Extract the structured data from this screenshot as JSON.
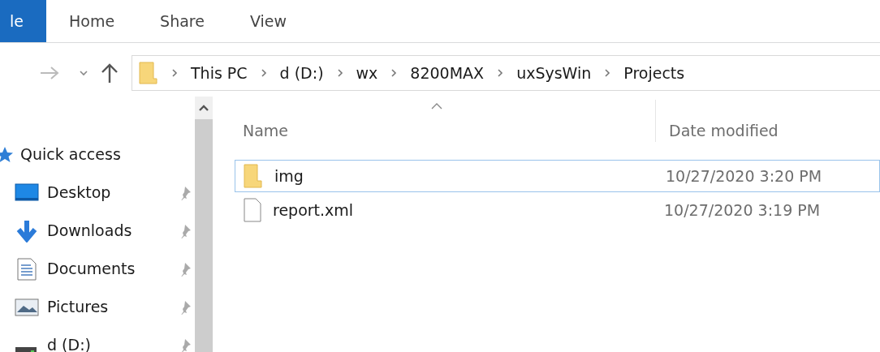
{
  "ribbon": {
    "tabs": [
      {
        "label": "le",
        "selected": true
      },
      {
        "label": "Home",
        "selected": false
      },
      {
        "label": "Share",
        "selected": false
      },
      {
        "label": "View",
        "selected": false
      }
    ]
  },
  "address_bar": {
    "crumbs": [
      "This PC",
      "d (D:)",
      "wx",
      "8200MAX",
      "uxSysWin",
      "Projects"
    ]
  },
  "navigation": {
    "items": [
      {
        "label": "Quick access",
        "kind": "quick",
        "pinned": false
      },
      {
        "label": "Desktop",
        "kind": "desktop",
        "pinned": true
      },
      {
        "label": "Downloads",
        "kind": "downloads",
        "pinned": true
      },
      {
        "label": "Documents",
        "kind": "documents",
        "pinned": true
      },
      {
        "label": "Pictures",
        "kind": "pictures",
        "pinned": true
      },
      {
        "label": "d (D:)",
        "kind": "drive",
        "pinned": true
      }
    ]
  },
  "file_list": {
    "columns": [
      "Name",
      "Date modified"
    ],
    "rows": [
      {
        "name": "img",
        "kind": "folder",
        "date_modified": "10/27/2020 3:20 PM",
        "focused": true
      },
      {
        "name": "report.xml",
        "kind": "file",
        "date_modified": "10/27/2020 3:19 PM",
        "focused": false
      }
    ]
  }
}
